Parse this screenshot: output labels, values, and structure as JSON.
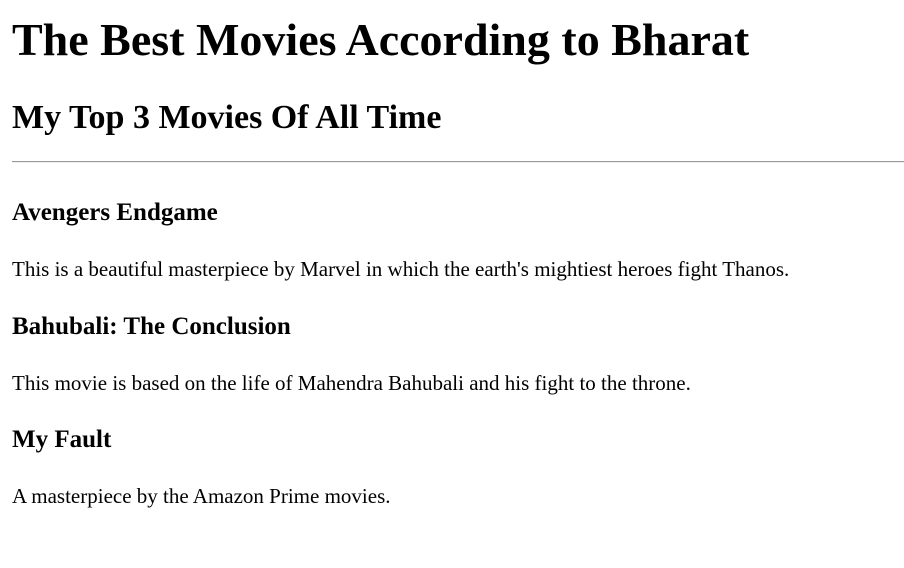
{
  "page": {
    "title": "The Best Movies According to Bharat",
    "subtitle": "My Top 3 Movies Of All Time"
  },
  "movies": [
    {
      "title": "Avengers Endgame",
      "description": "This is a beautiful masterpiece by Marvel in which the earth's mightiest heroes fight Thanos."
    },
    {
      "title": "Bahubali: The Conclusion",
      "description": "This movie is based on the life of Mahendra Bahubali and his fight to the throne."
    },
    {
      "title": "My Fault",
      "description": "A masterpiece by the Amazon Prime movies."
    }
  ]
}
